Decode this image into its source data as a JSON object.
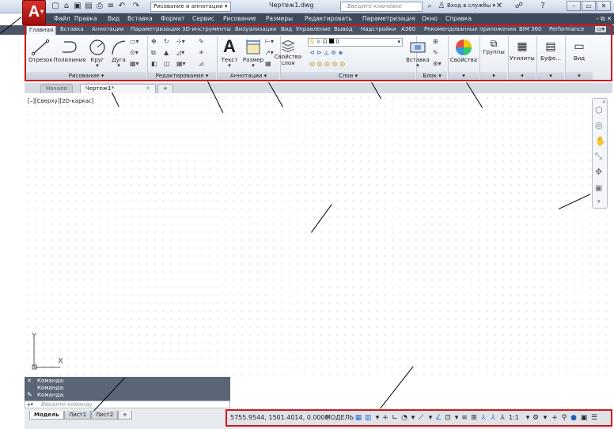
{
  "app": {
    "logo_letter": "A",
    "document_title": "Чертеж1.dwg",
    "workspace": "Рисование и аннотации",
    "search_placeholder": "Введите ключевое слово/фразу",
    "sign_in": "Вход в службы"
  },
  "menu": [
    "Файл",
    "Правка",
    "Вид",
    "Вставка",
    "Формат",
    "Сервис",
    "Рисование",
    "Размеры",
    "Редактировать",
    "Параметризация",
    "Окно",
    "Справка"
  ],
  "ribbon_tabs": [
    "Главная",
    "Вставка",
    "Аннотации",
    "Параметризация",
    "3D-инструменты",
    "Визуализация",
    "Вид",
    "Управление",
    "Вывод",
    "Надстройки",
    "A360",
    "Рекомендованные приложения",
    "BIM 360",
    "Performance"
  ],
  "ribbon": {
    "draw": {
      "line": "Отрезок",
      "polyline": "Полилиния",
      "circle": "Круг",
      "arc": "Дуга",
      "panel": "Рисование"
    },
    "modify": {
      "panel": "Редактирование"
    },
    "annotation": {
      "text": "Текст",
      "dimension": "Размер",
      "panel": "Аннотации"
    },
    "layers": {
      "props_line1": "Свойства",
      "props_line2": "слоя",
      "current_layer": "0",
      "panel": "Слои"
    },
    "block": {
      "insert": "Вставка",
      "panel": "Блок"
    },
    "properties": {
      "label": "Свойства"
    },
    "groups": {
      "label": "Группы"
    },
    "utilities": {
      "label": "Утилиты"
    },
    "clipboard": {
      "label": "Буфе..."
    },
    "view": {
      "label": "Вид"
    }
  },
  "doc_tabs": {
    "start": "Начало",
    "drawing": "Чертеж1*"
  },
  "viewport_controls": "[–][Сверху][2D-каркас]",
  "ucs": {
    "x": "X",
    "y": "Y"
  },
  "command": {
    "history": [
      "Команда:",
      "Команда:",
      "Команда:"
    ],
    "placeholder": "Введите команду"
  },
  "layout_tabs": [
    "Модель",
    "Лист1",
    "Лист2"
  ],
  "status": {
    "coords": "5755.9544, 1501.4014, 0.0000",
    "mode": "МОДЕЛЬ",
    "scale": "1:1"
  },
  "colors": {
    "accent": "#d41616",
    "menubar": "#3e4a5c"
  }
}
